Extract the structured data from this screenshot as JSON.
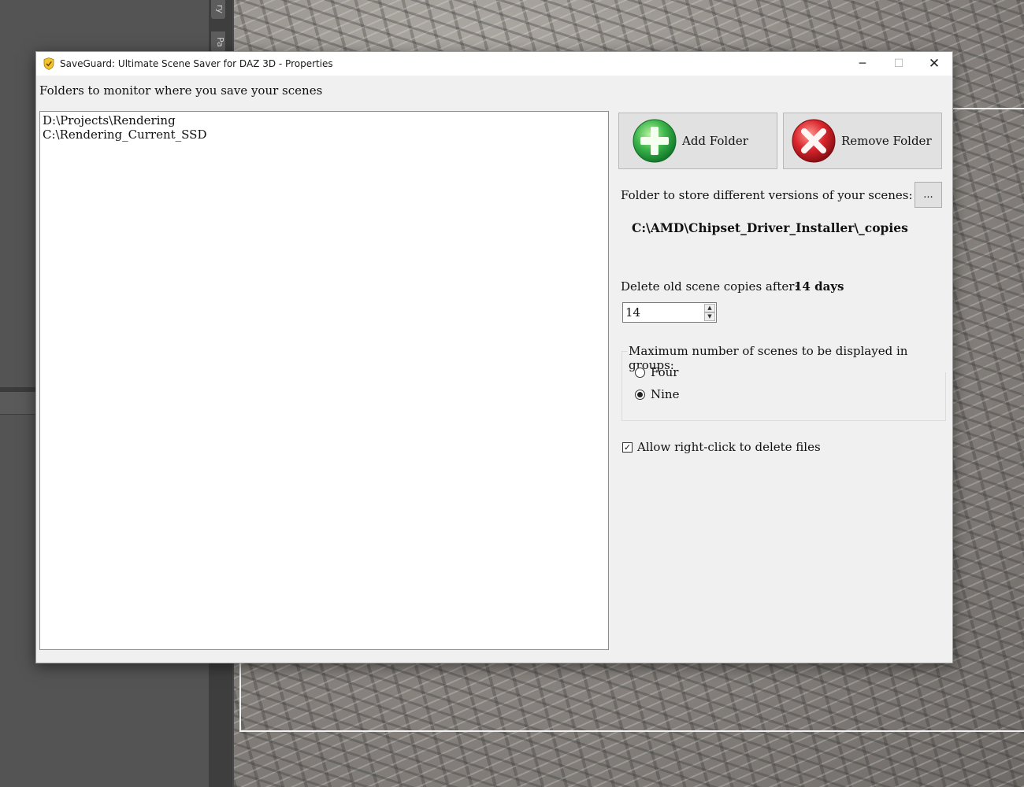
{
  "background_app": {
    "tabs": [
      "ry",
      "Pa"
    ]
  },
  "window": {
    "title": "SaveGuard: Ultimate Scene Saver for DAZ 3D - Properties",
    "minimize_glyph": "─",
    "maximize_glyph": "☐",
    "close_glyph": "✕",
    "icon": "shield-check-icon"
  },
  "monitor": {
    "label": "Folders to monitor where you save your scenes",
    "folders": [
      "D:\\Projects\\Rendering",
      "C:\\Rendering_Current_SSD"
    ]
  },
  "buttons": {
    "add_folder": "Add Folder",
    "remove_folder": "Remove Folder",
    "browse": "..."
  },
  "store": {
    "label": "Folder to store different versions of your scenes:",
    "path": "C:\\AMD\\Chipset_Driver_Installer\\_copies"
  },
  "delete": {
    "label": "Delete old scene copies after:",
    "value_text": "14 days",
    "spin_value": "14"
  },
  "groups": {
    "legend": "Maximum number of scenes to be displayed in groups:",
    "options": [
      {
        "label": "Four",
        "checked": false
      },
      {
        "label": "Nine",
        "checked": true
      }
    ]
  },
  "right_click": {
    "label": "Allow right-click to delete files",
    "checked": true,
    "check_glyph": "✓"
  },
  "colors": {
    "dialog_bg": "#f0f0f0",
    "add_icon": "#3cb44b",
    "remove_icon": "#d9262c"
  }
}
